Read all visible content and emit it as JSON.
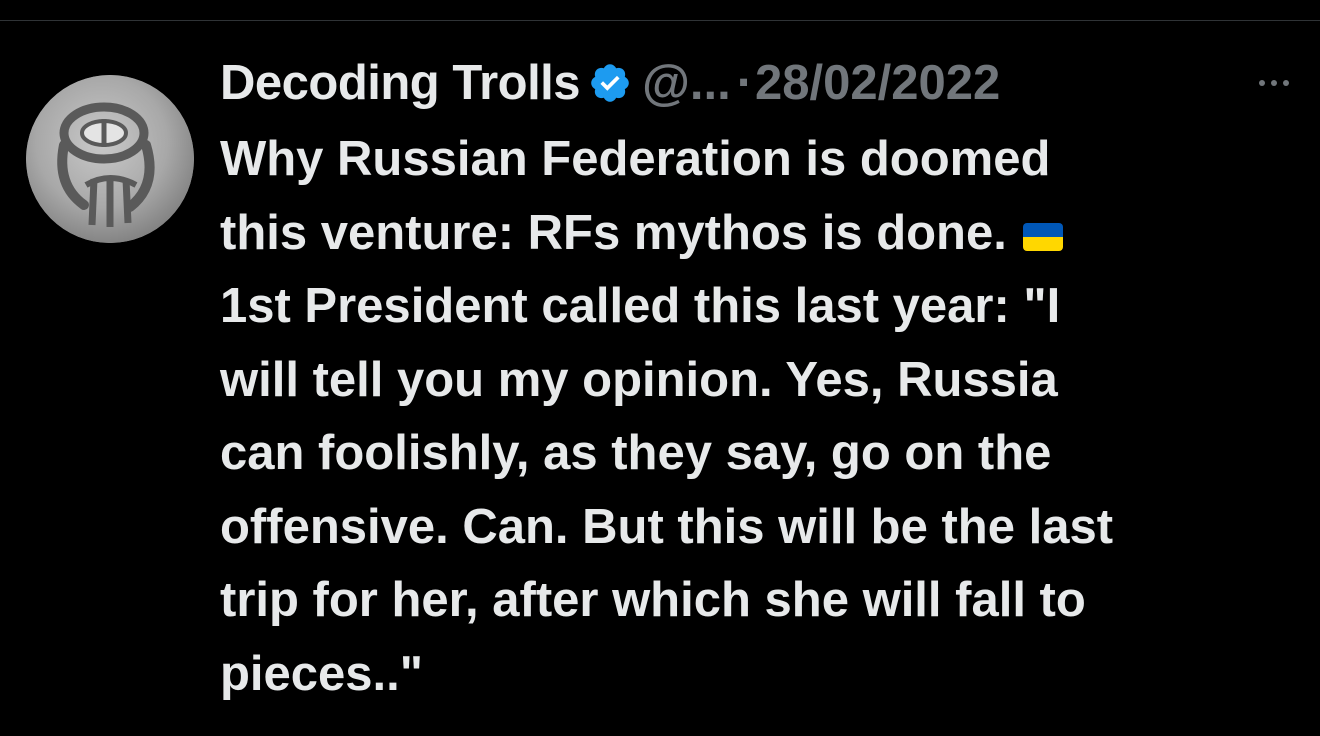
{
  "tweet": {
    "display_name": "Decoding Trolls",
    "handle": "@...",
    "separator": "·",
    "date": "28/02/2022",
    "text_line_1": "Why Russian Federation is doomed",
    "text_line_2": "this venture: RFs mythos is done.",
    "text_line_3": "1st President called this last year: \"I",
    "text_line_4": "will tell you my opinion. Yes, Russia",
    "text_line_5": "can foolishly, as they say, go on the",
    "text_line_6": "offensive. Can. But this will be the last",
    "text_line_7": "trip for her, after which she will fall to",
    "text_line_8": "pieces..\"",
    "emoji": "ukraine-flag",
    "avatar_icon": "stone-seal-avatar",
    "verified_icon": "verified-badge-icon",
    "more_icon": "more-options-icon"
  },
  "colors": {
    "background": "#000000",
    "primary_text": "#e7e9ea",
    "secondary_text": "#71767b",
    "verified_blue": "#1d9bf0",
    "flag_blue": "#0057b7",
    "flag_yellow": "#ffd700"
  }
}
